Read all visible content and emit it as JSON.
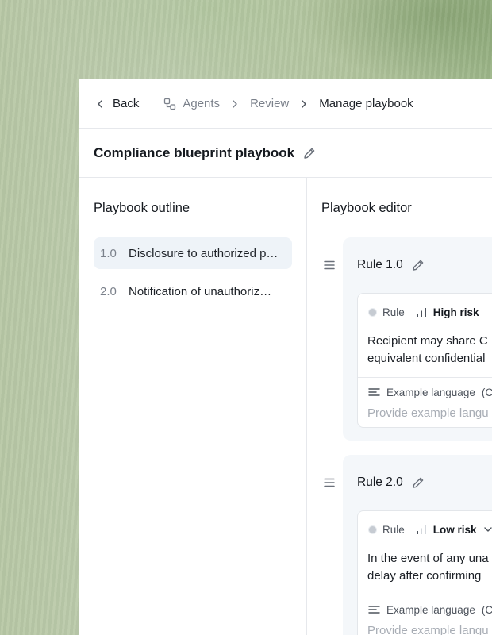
{
  "nav": {
    "back": "Back",
    "crumbs": [
      "Agents",
      "Review"
    ],
    "current": "Manage playbook"
  },
  "page_title": "Compliance blueprint playbook",
  "outline": {
    "title": "Playbook outline",
    "items": [
      {
        "num": "1.0",
        "text": "Disclosure to authorized p…"
      },
      {
        "num": "2.0",
        "text": "Notification of unauthoriz…"
      }
    ]
  },
  "editor": {
    "title": "Playbook editor",
    "rules": [
      {
        "name": "Rule 1.0",
        "tag": "Rule",
        "risk": "High risk",
        "risk_level": 3,
        "text_lines": [
          "Recipient may share C",
          "equivalent confidential"
        ],
        "example_label": "Example language",
        "example_suffix": "(C",
        "example_placeholder": "Provide example langu"
      },
      {
        "name": "Rule 2.0",
        "tag": "Rule",
        "risk": "Low risk",
        "risk_level": 1,
        "text_lines": [
          "In the event of any una",
          "delay after confirming"
        ],
        "example_label": "Example language",
        "example_suffix": "(C",
        "example_placeholder": "Provide example langu"
      }
    ]
  },
  "colors": {
    "accent_bg": "#eef3f8",
    "card_bg": "#f4f7fa",
    "text": "#1d2127",
    "muted": "#7b818b",
    "placeholder": "#a8adb5"
  }
}
